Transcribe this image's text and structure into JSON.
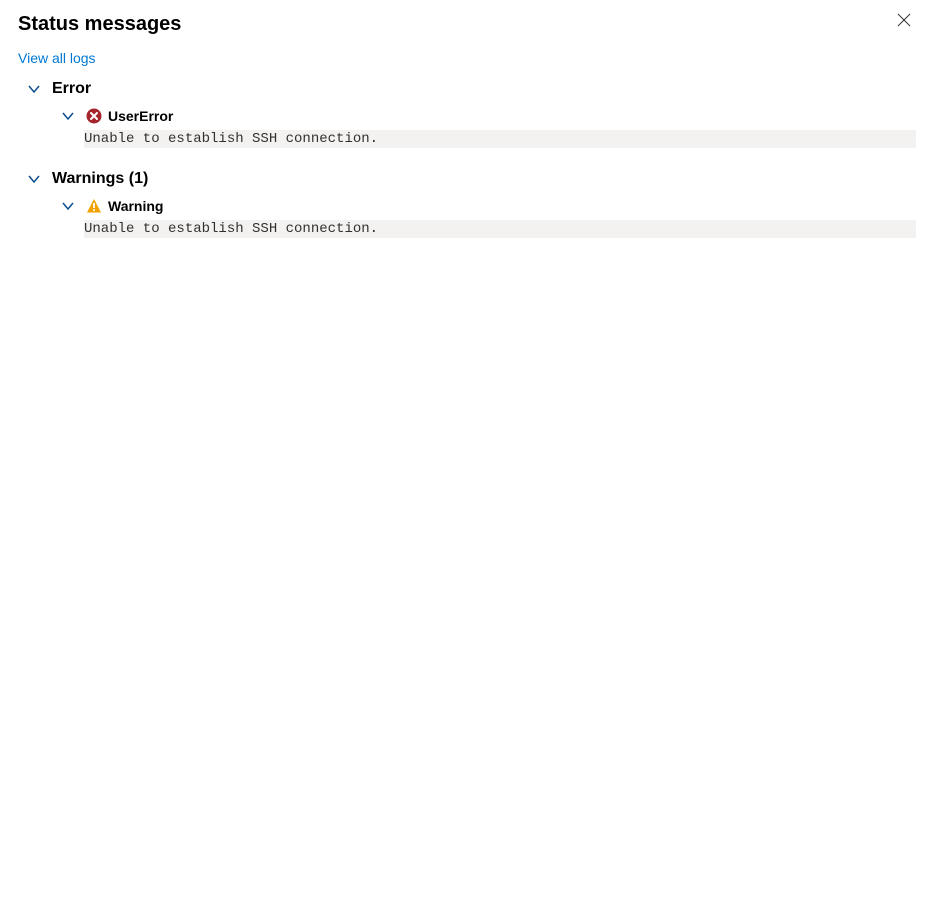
{
  "header": {
    "title": "Status messages"
  },
  "links": {
    "view_logs": "View all logs"
  },
  "sections": {
    "error": {
      "title": "Error",
      "item": {
        "label": "UserError",
        "message": "Unable to establish SSH connection."
      }
    },
    "warnings": {
      "title": "Warnings (1)",
      "item": {
        "label": "Warning",
        "message": "Unable to establish SSH connection."
      }
    }
  }
}
